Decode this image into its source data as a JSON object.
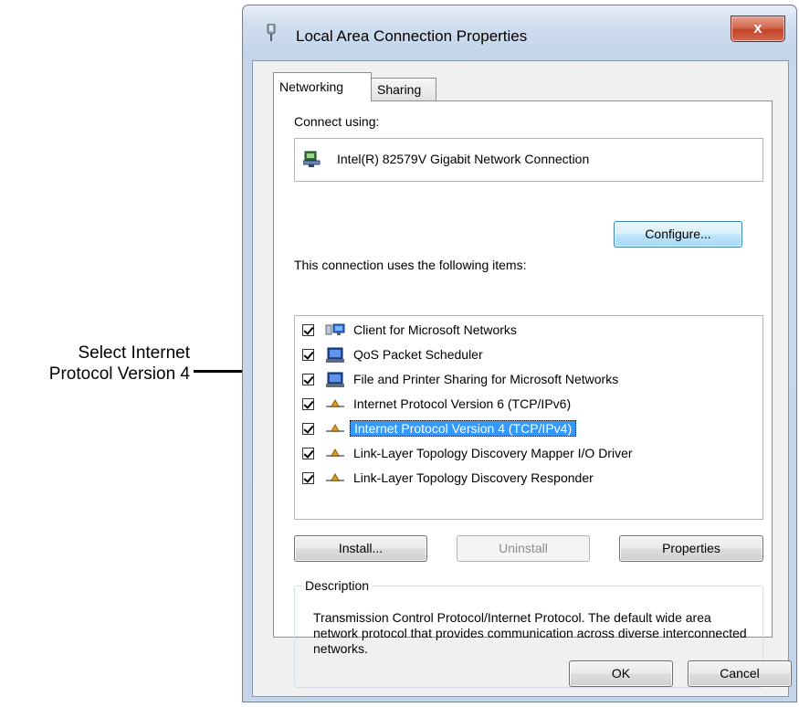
{
  "callout": {
    "line1": "Select Internet",
    "line2": "Protocol Version 4"
  },
  "window": {
    "title": "Local Area Connection Properties",
    "close_label": "x"
  },
  "tabs": [
    {
      "label": "Networking",
      "active": true
    },
    {
      "label": "Sharing",
      "active": false
    }
  ],
  "connect": {
    "label": "Connect using:",
    "adapter": "Intel(R) 82579V Gigabit Network Connection",
    "configure_button": "Configure..."
  },
  "items": {
    "label": "This connection uses the following items:",
    "list": [
      {
        "label": "Client for Microsoft Networks",
        "checked": true,
        "icon": "network-client-icon"
      },
      {
        "label": "QoS Packet Scheduler",
        "checked": true,
        "icon": "computer-service-icon"
      },
      {
        "label": "File and Printer Sharing for Microsoft Networks",
        "checked": true,
        "icon": "computer-service-icon"
      },
      {
        "label": "Internet Protocol Version 6 (TCP/IPv6)",
        "checked": true,
        "icon": "protocol-icon"
      },
      {
        "label": "Internet Protocol Version 4 (TCP/IPv4)",
        "checked": true,
        "icon": "protocol-icon",
        "selected": true
      },
      {
        "label": "Link-Layer Topology Discovery Mapper I/O Driver",
        "checked": true,
        "icon": "protocol-icon"
      },
      {
        "label": "Link-Layer Topology Discovery Responder",
        "checked": true,
        "icon": "protocol-icon"
      }
    ]
  },
  "buttons": {
    "install": "Install...",
    "uninstall": "Uninstall",
    "properties": "Properties",
    "ok": "OK",
    "cancel": "Cancel"
  },
  "description": {
    "title": "Description",
    "text": "Transmission Control Protocol/Internet Protocol. The default wide area network protocol that provides communication across diverse interconnected networks."
  },
  "colors": {
    "selection": "#3399ff",
    "close_button": "#c0432a"
  }
}
